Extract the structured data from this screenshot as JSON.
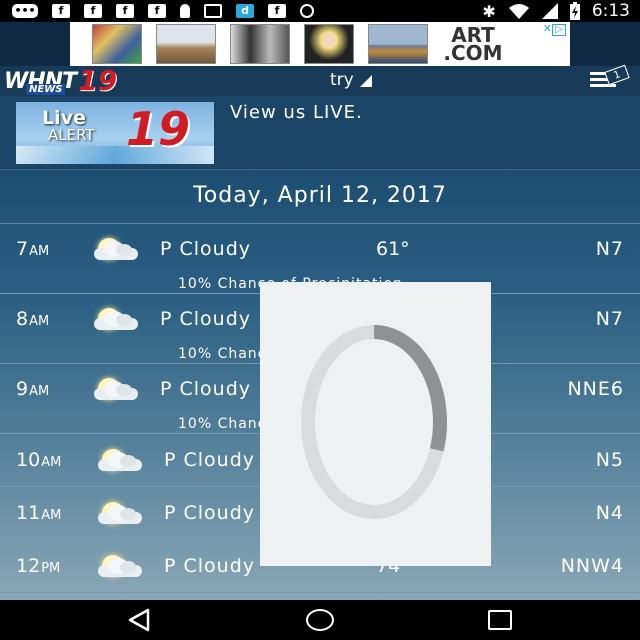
{
  "status_bar": {
    "time": "6:13",
    "left_icons": [
      "message-icon",
      "facebook-icon",
      "facebook-icon",
      "facebook-icon",
      "facebook-icon",
      "pin-icon",
      "card-icon",
      "dailyhunt-icon",
      "facebook-icon",
      "sync-icon"
    ],
    "right_icons": [
      "bluetooth-icon",
      "wifi-icon",
      "signal-icon",
      "battery-charging-icon"
    ],
    "facebook_glyph": "f",
    "dailyhunt_glyph": "d"
  },
  "ad": {
    "brand": "ART.COM",
    "brand_line1": "ART",
    "brand_line2": ".COM"
  },
  "header": {
    "logo_main": "WHNT",
    "logo_sub": "NEWS",
    "logo_number": "19",
    "location_selector": "try",
    "menu_badge": "1"
  },
  "live": {
    "image_line1": "Live",
    "image_line2": "ALERT",
    "image_number": "19",
    "caption": "View us LIVE."
  },
  "forecast": {
    "date": "Today, April 12, 2017",
    "hours": [
      {
        "hour": "7",
        "ampm": "AM",
        "condition": "P Cloudy",
        "temp": "61°",
        "wind": "N7",
        "precip": "10% Chance of Precipitation"
      },
      {
        "hour": "8",
        "ampm": "AM",
        "condition": "P Cloudy",
        "temp": "",
        "wind": "N7",
        "precip": "10% Chance"
      },
      {
        "hour": "9",
        "ampm": "AM",
        "condition": "P Cloudy",
        "temp": "",
        "wind": "NNE6",
        "precip": "10% Chance"
      },
      {
        "hour": "10",
        "ampm": "AM",
        "condition": "P Cloudy",
        "temp": "",
        "wind": "N5",
        "precip": ""
      },
      {
        "hour": "11",
        "ampm": "AM",
        "condition": "P Cloudy",
        "temp": "",
        "wind": "N4",
        "precip": ""
      },
      {
        "hour": "12",
        "ampm": "PM",
        "condition": "P Cloudy",
        "temp": "74",
        "wind": "NNW4",
        "precip": ""
      }
    ]
  },
  "loading": {
    "progress": 0.3
  },
  "colors": {
    "brand_red": "#d21c24",
    "header_blue": "#173a58",
    "content_top": "#1d4e72"
  }
}
